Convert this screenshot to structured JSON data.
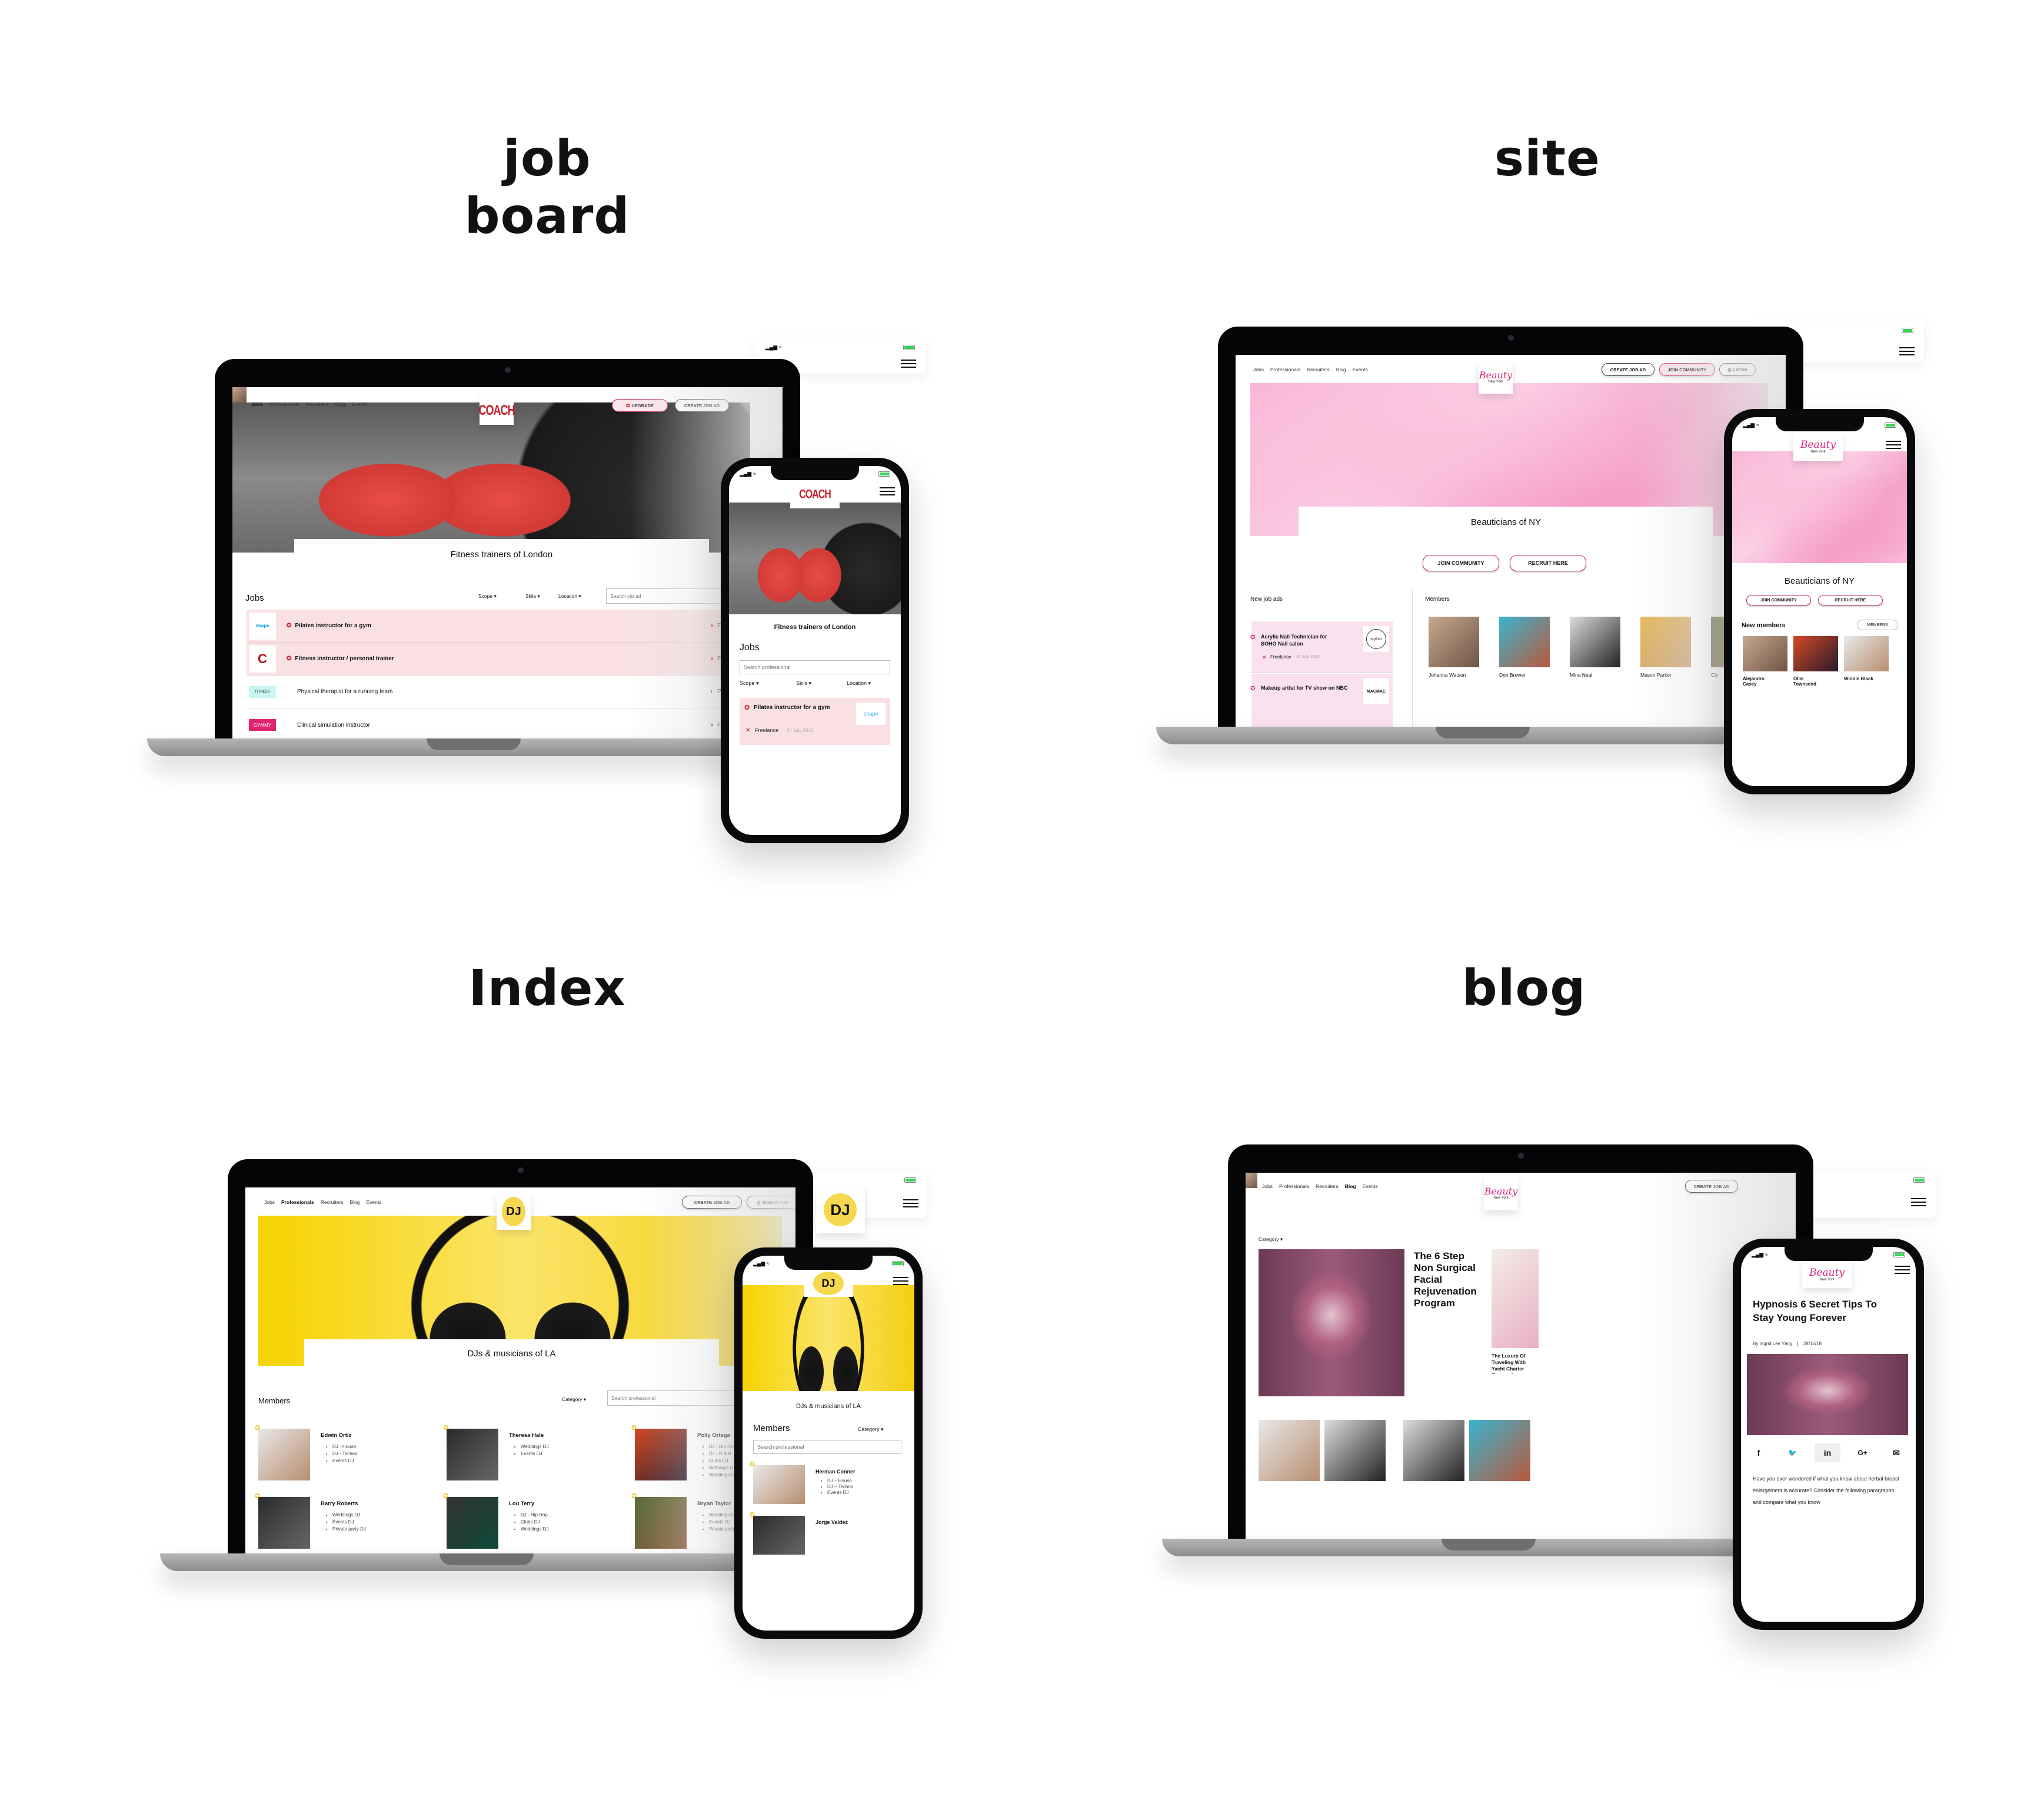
{
  "sections": {
    "job_board": "job board",
    "site": "site",
    "index": "Index",
    "blog": "blog"
  },
  "colors": {
    "coach_red": "#c4212d",
    "beauty_pink": "#d6257a",
    "dj_yellow": "#f5d84e",
    "featured_row_bg": "#f9e1e3",
    "battery_green": "#3cd45a"
  },
  "coach": {
    "logo": "COACH",
    "nav": [
      "Jobs",
      "Professionals",
      "Recruiters",
      "Blog",
      "Events"
    ],
    "nav_active": "Jobs",
    "upgrade_label": "UPGRADE",
    "create_job_label": "CREATE JOB AD",
    "hero_title": "Fitness trainers of London",
    "jobs_heading": "Jobs",
    "filters": [
      "Scope",
      "Skils",
      "Location"
    ],
    "search_placeholder": "Search job ad",
    "jobs": [
      {
        "company": "shape",
        "title": "Pilates instructor for a gym",
        "type": "Full time",
        "featured": true
      },
      {
        "company": "C",
        "title": "Fitness instructor / personal trainer",
        "type": "Full time",
        "featured": true
      },
      {
        "company": "FITNESS",
        "title": "Physical therapist for a running team",
        "type": "Part time",
        "featured": false
      },
      {
        "company": "GYMMY",
        "title": "Clinical simulation instructor",
        "type": "Full time",
        "featured": false
      }
    ],
    "mobile": {
      "search_placeholder": "Search professional",
      "job_title": "Pilates instructor for a gym",
      "job_type": "Freelance",
      "job_date": "24 July 2018",
      "company": "shape"
    }
  },
  "beauty_site": {
    "logo": "Beauty",
    "logo_sub": "New York",
    "nav": [
      "Jobs",
      "Professionals",
      "Recruiters",
      "Blog",
      "Events"
    ],
    "create_job_label": "CREATE JOB AD",
    "join_label": "JOIN COMMUNITY",
    "login_label": "LOGIN",
    "hero_title": "Beauticians of NY",
    "cta_join": "JOIN COMMUNITY",
    "cta_recruit": "RECRUIT HERE",
    "new_jobs_heading": "New job ads",
    "members_heading": "Members",
    "job_ads": [
      {
        "title": "Acrylic Nail Technician for SOHO Nail salon",
        "type": "Freelance",
        "date": "24 July 2018",
        "company": "stylish"
      },
      {
        "title": "Makeup artist for TV show on NBC",
        "company": "MACMAC"
      }
    ],
    "members": [
      "Johanna Watson",
      "Don Brewer",
      "Mina Neal",
      "Mason Parker",
      "Cly"
    ],
    "mobile": {
      "new_members_heading": "New members",
      "members_button": "MEMBERS",
      "members": [
        "Alejandro Casey",
        "Ollie Townsend",
        "Winnie Black"
      ]
    }
  },
  "dj": {
    "logo": "DJ",
    "nav": [
      "Jobs",
      "Professionals",
      "Recruiters",
      "Blog",
      "Events"
    ],
    "nav_active": "Professionals",
    "create_job_label": "CREATE JOB AD",
    "signin_label": "SIGN IN / UP",
    "hero_title": "DJs & musicians of LA",
    "members_heading": "Members",
    "category_label": "Category",
    "search_placeholder": "Search professional",
    "members": [
      {
        "name": "Edwin Ortiz",
        "skills": [
          "DJ - House",
          "DJ - Techno",
          "Events DJ"
        ]
      },
      {
        "name": "Theresa Hale",
        "skills": [
          "Weddings DJ",
          "Events DJ"
        ]
      },
      {
        "name": "Polly Ortega",
        "skills": [
          "DJ - Hip Hop",
          "DJ - R & B",
          "Clubs DJ",
          "Birthdays DJ",
          "Weddings DJ"
        ]
      },
      {
        "name": "Barry Roberts",
        "skills": [
          "Weddings DJ",
          "Events DJ",
          "Private party DJ"
        ]
      },
      {
        "name": "Lou Terry",
        "skills": [
          "DJ - Hip Hop",
          "Clubs DJ",
          "Weddings DJ"
        ]
      },
      {
        "name": "Bryan Taylor",
        "skills": [
          "Weddings DJ",
          "Events DJ",
          "Private party DJ"
        ]
      }
    ],
    "mobile": {
      "members": [
        {
          "name": "Herman Conner",
          "skills": [
            "DJ – House",
            "DJ – Techno",
            "Events DJ"
          ]
        },
        {
          "name": "Jorge Valdez",
          "skills": []
        }
      ]
    }
  },
  "blog": {
    "logo": "Beauty",
    "logo_sub": "New York",
    "nav": [
      "Jobs",
      "Professionals",
      "Recruiters",
      "Blog",
      "Events"
    ],
    "nav_active": "Blog",
    "create_job_label": "CREATE JOB AD",
    "category_label": "Category",
    "featured_title": "The 6 Step Non Surgical Facial Rejuvenation Program",
    "side_title": "The Luxury Of Traveling With Yacht Charter Companies",
    "mobile": {
      "title": "Hypnosis 6 Secret Tips To Stay Young Forever",
      "author": "By Ingrid Lee Yang",
      "separator": "|",
      "date": "28/12/18",
      "share": [
        "f",
        "twitter",
        "in",
        "G+",
        "mail"
      ],
      "body": "Have you ever wondered if what you know about herbal breast enlargement is accurate? Consider the following paragraphs and compare what you know"
    }
  }
}
